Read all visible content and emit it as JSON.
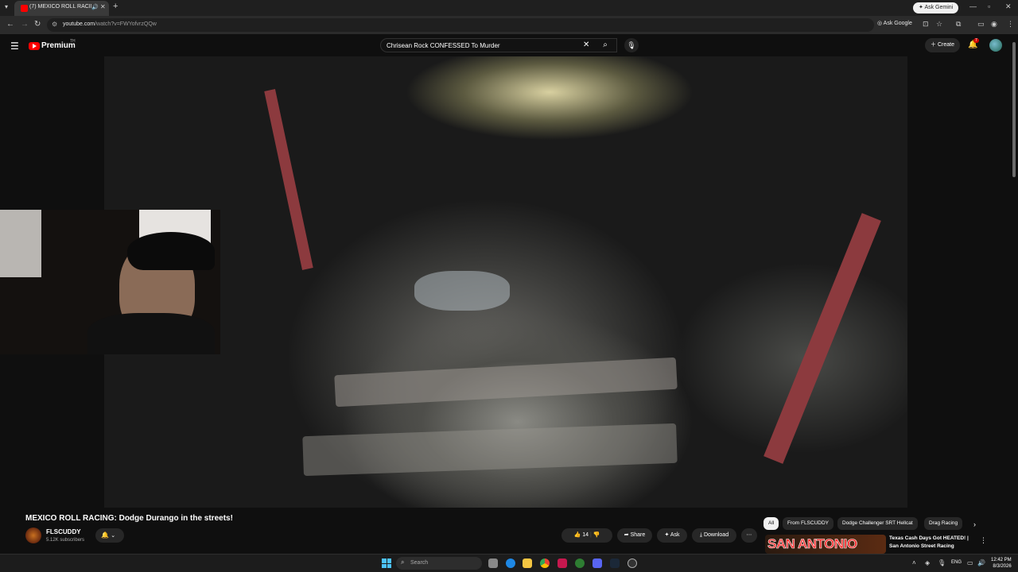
{
  "browser": {
    "tab_title": "(7) MEXICO ROLL RACING: D",
    "ask_gemini": "Ask Gemini",
    "url_host": "youtube.com",
    "url_path": "/watch?v=FWYofvrzQQw",
    "ask_google": "Ask Google"
  },
  "youtube": {
    "premium_label": "Premium",
    "premium_sup": "TH",
    "search_query": "Chrisean Rock CONFESSED To Murder",
    "create_label": "Create",
    "notification_count": "7"
  },
  "video": {
    "title": "MEXICO ROLL RACING: Dodge Durango in the streets!",
    "channel_name": "FLSCUDDY",
    "subscribers": "5.12K subscribers",
    "like_count": "14",
    "share_label": "Share",
    "ask_label": "Ask",
    "download_label": "Download"
  },
  "chips": [
    "All",
    "From FLSCUDDY",
    "Dodge Challenger SRT Hellcat",
    "Drag Racing"
  ],
  "recommendation": {
    "thumbnail_text": "SAN ANTONIO",
    "title": "Texas Cash Days Got HEATED! | San Antonio Street Racing"
  },
  "taskbar": {
    "search_placeholder": "Search",
    "language": "ENG",
    "time": "12:42 PM",
    "date": "8/3/2026"
  },
  "colors": {
    "accent_red": "#ff0000",
    "background": "#0f0f0f",
    "pill_bg": "#272727"
  }
}
